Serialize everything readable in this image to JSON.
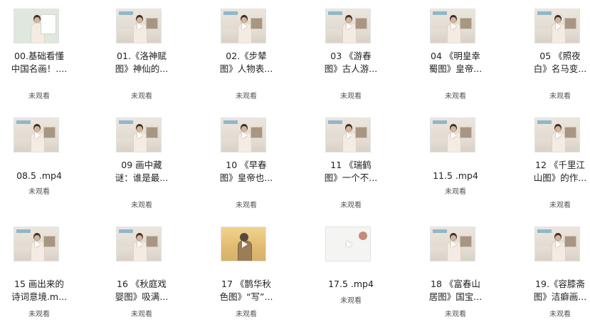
{
  "items": [
    {
      "line1": "00.基础看懂",
      "line2": "中国名画！....",
      "status": "未观看"
    },
    {
      "line1": "01.《洛神赋",
      "line2": "图》神仙的...",
      "status": "未观看"
    },
    {
      "line1": "02.《步辇",
      "line2": "图》人物表...",
      "status": "未观看"
    },
    {
      "line1": "03 《游春",
      "line2": "图》古人游...",
      "status": "未观看"
    },
    {
      "line1": "04 《明皇幸",
      "line2": "蜀图》皇帝...",
      "status": "未观看"
    },
    {
      "line1": "05 《照夜",
      "line2": "白》名马变...",
      "status": "未观看"
    },
    {
      "line1": "08.5 .mp4",
      "line2": "",
      "status": "未观看"
    },
    {
      "line1": "09 画中藏",
      "line2": "谜：谁是最...",
      "status": "未观看"
    },
    {
      "line1": "10 《早春",
      "line2": "图》皇帝也...",
      "status": "未观看"
    },
    {
      "line1": "11 《瑞鹤",
      "line2": "图》一个不...",
      "status": "未观看"
    },
    {
      "line1": "11.5 .mp4",
      "line2": "",
      "status": "未观看"
    },
    {
      "line1": "12 《千里江",
      "line2": "山图》的作...",
      "status": "未观看"
    },
    {
      "line1": "15 画出来的",
      "line2": "诗词意境.m...",
      "status": "未观看"
    },
    {
      "line1": "16 《秋庭戏",
      "line2": "婴图》吸满...",
      "status": "未观看"
    },
    {
      "line1": "17 《鹊华秋",
      "line2": "色图》“写”...",
      "status": "未观看"
    },
    {
      "line1": "17.5 .mp4",
      "line2": "",
      "status": "未观看"
    },
    {
      "line1": "18 《富春山",
      "line2": "居图》国宝...",
      "status": "未观看"
    },
    {
      "line1": "19.《容膝斋",
      "line2": "图》洁癖画...",
      "status": "未观看"
    }
  ]
}
